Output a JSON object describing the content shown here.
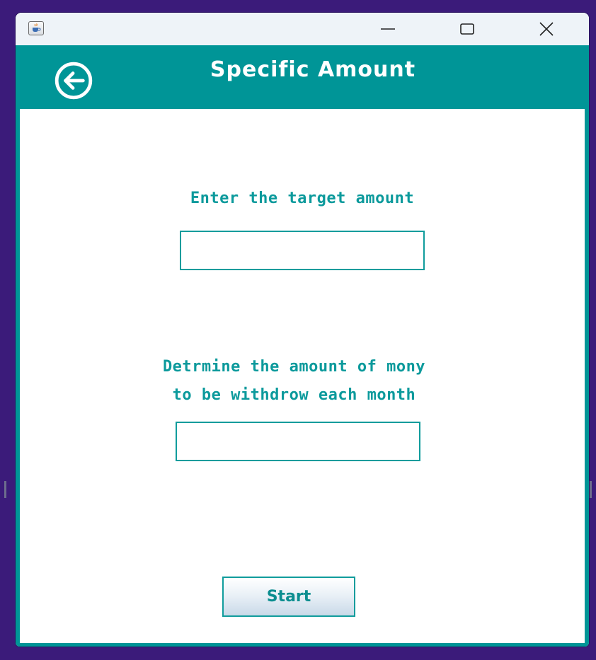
{
  "window": {
    "app_icon": "java-coffee-icon",
    "controls": {
      "minimize_icon": "minimize-icon",
      "maximize_icon": "maximize-icon",
      "close_icon": "close-icon"
    }
  },
  "header": {
    "back_icon": "arrow-left-circle-icon",
    "title": "Specific Amount",
    "background": "#009597"
  },
  "form": {
    "target_label": "Enter the target amount",
    "target_value": "",
    "monthly_label_line1": "Detrmine the amount of mony",
    "monthly_label_line2": "to be withdrow each month",
    "monthly_value": "",
    "start_label": "Start"
  },
  "colors": {
    "accent": "#009597",
    "label_text": "#0c9a9c",
    "desktop": "#3b1b7a"
  }
}
